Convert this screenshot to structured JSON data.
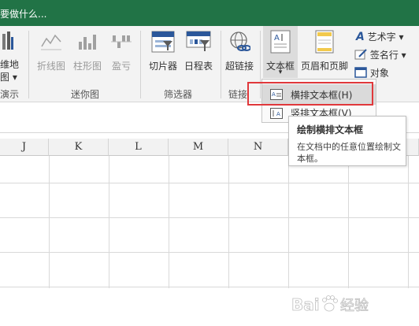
{
  "titlebar": {
    "tell_me": "要做什么..."
  },
  "ribbon": {
    "partial_button": {
      "line1": "维地",
      "line2": "图 ▾",
      "group": "演示"
    },
    "sparklines": {
      "line": "折线图",
      "column": "柱形图",
      "win_loss": "盈亏",
      "group": "迷你图"
    },
    "filters": {
      "slicer": "切片器",
      "timeline": "日程表",
      "group": "筛选器"
    },
    "links": {
      "hyperlink": "超链接",
      "group": "链接"
    },
    "text": {
      "textbox": "文本框",
      "textbox_arrow": "▾",
      "header_footer": "页眉和页脚",
      "wordart": "艺术字 ▾",
      "signature": "签名行 ▾",
      "object": "对象"
    }
  },
  "dropdown": {
    "items": [
      {
        "label": "横排文本框(H)",
        "highlighted": true
      },
      {
        "label": "竖排文本框(V)",
        "highlighted": false
      }
    ]
  },
  "tooltip": {
    "title": "绘制横排文本框",
    "description": "在文档中的任意位置绘制文本框。"
  },
  "sheet": {
    "columns": [
      "J",
      "K",
      "L",
      "M",
      "N",
      "",
      ""
    ]
  },
  "colors": {
    "titlebar": "#217346",
    "highlight_box": "#e0383b",
    "accent_blue": "#2b579a"
  },
  "watermark": {
    "text": "Bai 经验"
  }
}
